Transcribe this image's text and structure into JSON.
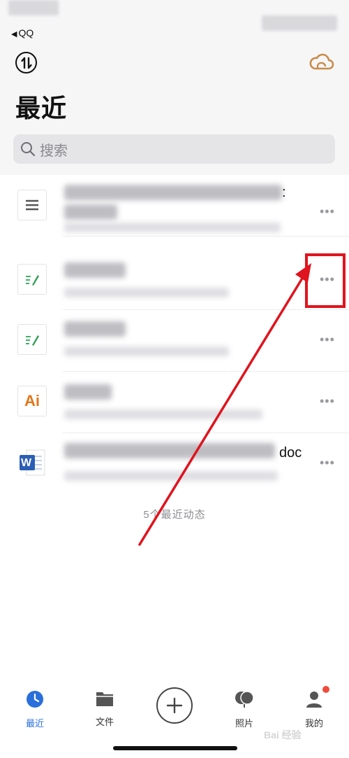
{
  "status": {
    "back_app": "QQ"
  },
  "header": {
    "title": "最近",
    "search_placeholder": "搜索"
  },
  "files": [
    {
      "type": "text-document",
      "visible_suffix": ":"
    },
    {
      "type": "note",
      "visible_suffix": ""
    },
    {
      "type": "note",
      "visible_suffix": ""
    },
    {
      "type": "illustrator",
      "visible_suffix": ""
    },
    {
      "type": "word",
      "visible_suffix": "doc"
    }
  ],
  "list_footer": "5个最近动态",
  "tabbar": {
    "tabs": [
      {
        "label": "最近",
        "icon": "clock-icon",
        "active": true
      },
      {
        "label": "文件",
        "icon": "folder-icon",
        "active": false
      },
      {
        "label": "照片",
        "icon": "photos-icon",
        "active": false
      },
      {
        "label": "我的",
        "icon": "person-icon",
        "active": false
      }
    ]
  },
  "icons": {
    "ai_label": "Ai",
    "word_label": "W",
    "watermark": "Bai 经验"
  },
  "colors": {
    "accent": "#2a6fdb",
    "annotation": "#e0141e",
    "cloud": "#c98b4a",
    "badge": "#f04b3c"
  }
}
